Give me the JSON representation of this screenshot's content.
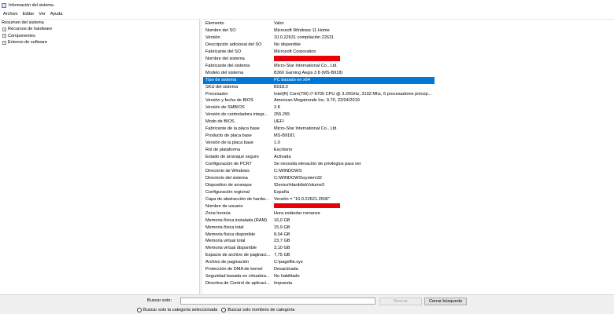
{
  "window": {
    "title": "Información del sistema",
    "app_icon": "system-info-icon"
  },
  "menu": [
    "Archivo",
    "Editar",
    "Ver",
    "Ayuda"
  ],
  "tree": {
    "root": "Resumen del sistema",
    "children": [
      "Recursos de hardware",
      "Componentes",
      "Entorno de software"
    ]
  },
  "grid": {
    "headers": {
      "name": "Elemento",
      "value": "Valor"
    },
    "selected_index": 8,
    "rows": [
      {
        "name": "Nombre del SO",
        "value": "Microsoft Windows 11 Home"
      },
      {
        "name": "Versión",
        "value": "10.0.22631 compilación 22631"
      },
      {
        "name": "Descripción adicional del SO",
        "value": "No disponible"
      },
      {
        "name": "Fabricante del SO",
        "value": "Microsoft Corporation"
      },
      {
        "name": "Nombre del sistema",
        "value": "",
        "redacted": true
      },
      {
        "name": "Fabricante del sistema",
        "value": "Micro-Star International Co., Ltd."
      },
      {
        "name": "Modelo del sistema",
        "value": "B360 Gaming Aegis 3 8 (MS-B918)"
      },
      {
        "name": "Tipo de sistema",
        "value": "PC basado en x64"
      },
      {
        "name": "SKU del sistema",
        "value": "B918.0"
      },
      {
        "name": "Procesador",
        "value": "Intel(R) Core(TM) i7-8700 CPU @ 3.20GHz, 3192 Mhz, 6 procesadores princip..."
      },
      {
        "name": "Versión y fecha de BIOS",
        "value": "American Megatrends Inc. 9.70, 22/04/2019"
      },
      {
        "name": "Versión de SMBIOS",
        "value": "2.8"
      },
      {
        "name": "Versión de controladora integr...",
        "value": "255.255"
      },
      {
        "name": "Modo de BIOS",
        "value": "UEFI"
      },
      {
        "name": "Fabricante de la placa base",
        "value": "Micro-Star International Co., Ltd."
      },
      {
        "name": "Producto de placa base",
        "value": "MS-B9181"
      },
      {
        "name": "Versión de la placa base",
        "value": "1.0"
      },
      {
        "name": "Rol de plataforma",
        "value": "Escritorio"
      },
      {
        "name": "Estado de arranque seguro",
        "value": "Activada"
      },
      {
        "name": "Configuración de PCR7",
        "value": "Se necesita elevación de privilegios para ver"
      },
      {
        "name": "Directorio de Windows",
        "value": "C:\\WINDOWS"
      },
      {
        "name": "Directorio del sistema",
        "value": "C:\\WINDOWS\\system32"
      },
      {
        "name": "Dispositivo de arranque",
        "value": "\\Device\\HarddiskVolume3"
      },
      {
        "name": "Configuración regional",
        "value": "España"
      },
      {
        "name": "Capa de abstracción de hardw...",
        "value": "Versión = \"10.0.22621.2506\""
      },
      {
        "name": "Nombre de usuario",
        "value": "",
        "redacted": true
      },
      {
        "name": "Zona horaria",
        "value": "Hora estándar romance"
      },
      {
        "name": "Memoria física instalada (RAM)",
        "value": "16,0 GB"
      },
      {
        "name": "Memoria física total",
        "value": "15,9 GB"
      },
      {
        "name": "Memoria física disponible",
        "value": "8,04 GB"
      },
      {
        "name": "Memoria virtual total",
        "value": "23,7 GB"
      },
      {
        "name": "Memoria virtual disponible",
        "value": "3,10 GB"
      },
      {
        "name": "Espacio de archivo de paginaci...",
        "value": "7,75 GB"
      },
      {
        "name": "Archivo de paginación",
        "value": "C:\\pagefile.sys"
      },
      {
        "name": "Protección de DMA de kernel",
        "value": "Desactivada"
      },
      {
        "name": "Seguridad basada en virtualiza...",
        "value": "No habilitado"
      },
      {
        "name": "Directiva de Control de aplicaci...",
        "value": "Impuesta"
      }
    ]
  },
  "search": {
    "label": "Buscar esto:",
    "value": "",
    "find_button": "Buscar",
    "clear_button": "Cerrar búsqueda",
    "option_selected_category": "Buscar solo la categoría seleccionada",
    "option_category_names": "Buscar solo nombres de categoría"
  },
  "colors": {
    "selection": "#0078d7",
    "redaction": "#e8000b"
  }
}
